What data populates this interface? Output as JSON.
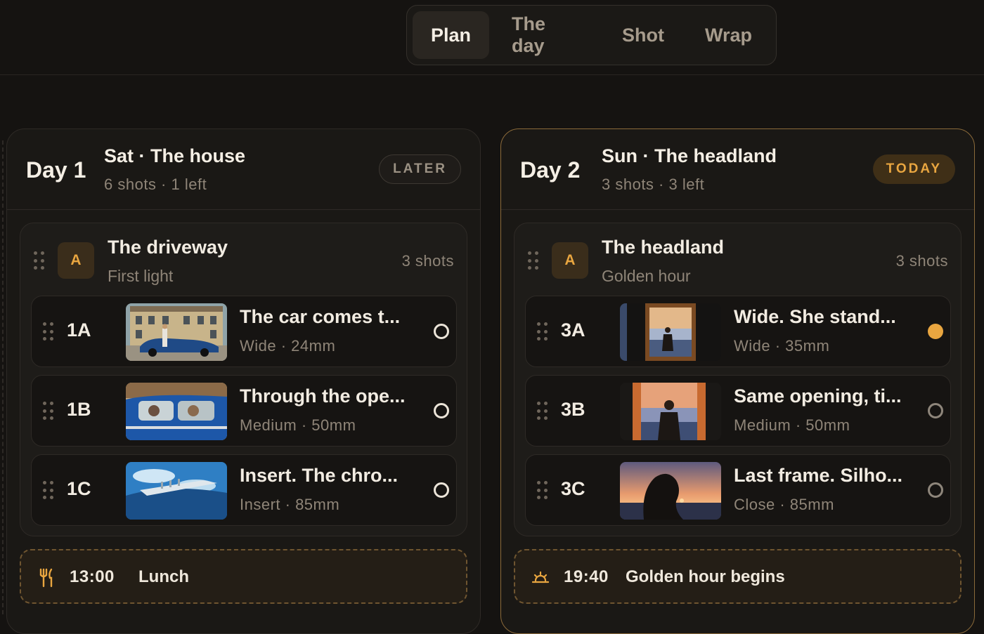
{
  "tabs": [
    {
      "label": "Plan",
      "active": true
    },
    {
      "label": "The day",
      "active": false
    },
    {
      "label": "Shot",
      "active": false
    },
    {
      "label": "Wrap",
      "active": false
    }
  ],
  "colors": {
    "accent": "#e9a640",
    "background": "#151311",
    "card": "#1a1815"
  },
  "days": [
    {
      "num": "Day 1",
      "title": "Sat · The house",
      "sub": "6 shots · 1 left",
      "badge": "LATER",
      "scene": {
        "letter": "A",
        "title": "The driveway",
        "sub": "First light",
        "count": "3 shots",
        "shots": [
          {
            "id": "1A",
            "title": "The car comes t...",
            "meta": "Wide · 24mm",
            "status": "open",
            "thumb": "house-car-thumbnail"
          },
          {
            "id": "1B",
            "title": "Through the ope...",
            "meta": "Medium · 50mm",
            "status": "open",
            "thumb": "car-interior-thumbnail"
          },
          {
            "id": "1C",
            "title": "Insert. The chro...",
            "meta": "Insert · 85mm",
            "status": "open",
            "thumb": "chrome-detail-thumbnail"
          }
        ]
      },
      "event": {
        "icon": "utensils-icon",
        "time": "13:00",
        "label": "Lunch"
      }
    },
    {
      "num": "Day 2",
      "title": "Sun · The headland",
      "sub": "3 shots · 3 left",
      "badge": "TODAY",
      "scene": {
        "letter": "A",
        "title": "The headland",
        "sub": "Golden hour",
        "count": "3 shots",
        "shots": [
          {
            "id": "3A",
            "title": "Wide. She stand...",
            "meta": "Wide · 35mm",
            "status": "current",
            "thumb": "doorway-wide-thumbnail"
          },
          {
            "id": "3B",
            "title": "Same opening, ti...",
            "meta": "Medium · 50mm",
            "status": "open",
            "thumb": "doorway-medium-thumbnail"
          },
          {
            "id": "3C",
            "title": "Last frame. Silho...",
            "meta": "Close · 85mm",
            "status": "open",
            "thumb": "silhouette-thumbnail"
          }
        ]
      },
      "event": {
        "icon": "sunrise-icon",
        "time": "19:40",
        "label": "Golden hour begins"
      }
    }
  ]
}
